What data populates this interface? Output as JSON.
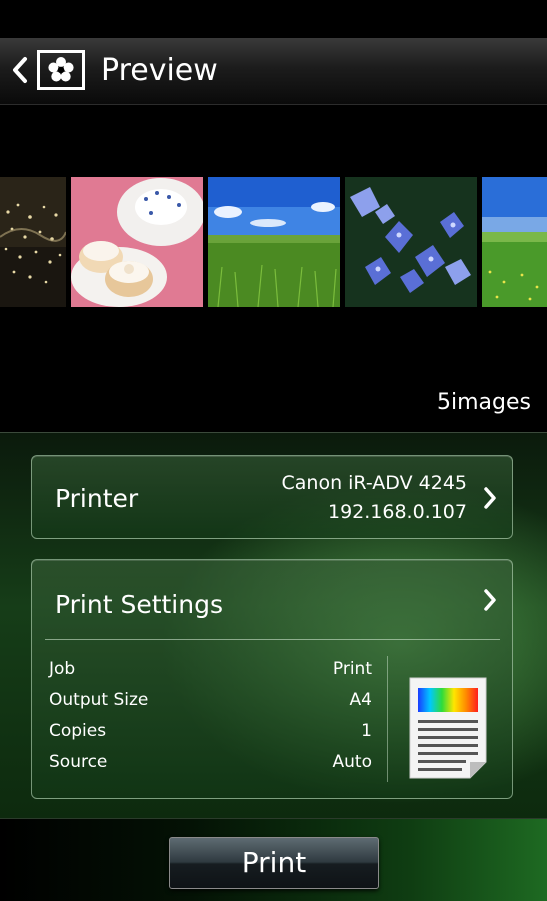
{
  "header": {
    "back_icon": "chevron-left-icon",
    "app_icon": "flower-icon",
    "title": "Preview"
  },
  "gallery": {
    "images": [
      {
        "name": "night-lights-thumbnail"
      },
      {
        "name": "cupcakes-thumbnail"
      },
      {
        "name": "green-field-thumbnail"
      },
      {
        "name": "blue-hydrangea-thumbnail"
      },
      {
        "name": "meadow-thumbnail"
      }
    ],
    "count_label": "5images"
  },
  "printer": {
    "label": "Printer",
    "name": "Canon iR-ADV 4245",
    "ip": "192.168.0.107",
    "chevron_icon": "chevron-right-icon"
  },
  "settings": {
    "title": "Print Settings",
    "chevron_icon": "chevron-right-icon",
    "rows": [
      {
        "key": "Job",
        "value": "Print"
      },
      {
        "key": "Output Size",
        "value": "A4"
      },
      {
        "key": "Copies",
        "value": "1"
      },
      {
        "key": "Source",
        "value": "Auto"
      }
    ],
    "document_icon": "document-preview-icon"
  },
  "actions": {
    "print_label": "Print"
  },
  "colors": {
    "panel_green": "#1e6a22",
    "header_dark": "#1c1c1c"
  }
}
